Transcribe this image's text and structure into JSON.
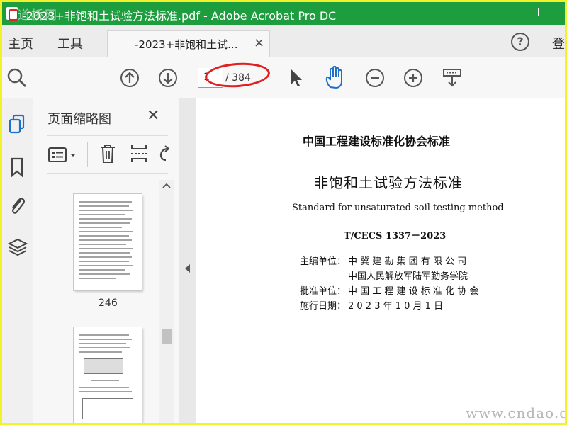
{
  "window": {
    "title": "-2023+非饱和土试验方法标准.pdf - Adobe Acrobat Pro DC",
    "watermark": "道桥网",
    "accent": "#1e9d3f"
  },
  "menu": {
    "home": "主页",
    "tools": "工具",
    "doc_tab": "-2023+非饱和土试...",
    "login": "登"
  },
  "toolbar": {
    "page_current": "1",
    "page_total": "/ 384",
    "icons": [
      "zoom-icon",
      "page-up-icon",
      "page-down-icon",
      "select-arrow-icon",
      "hand-icon",
      "zoom-out-icon",
      "zoom-in-icon",
      "keyboard-scroll-icon"
    ]
  },
  "sidebar": {
    "panel_title": "页面缩略图",
    "thumbnails": [
      {
        "label": "246"
      },
      {
        "label": ""
      }
    ]
  },
  "document": {
    "org_standard": "中国工程建设标准化协会标准",
    "title_cn": "非饱和土试验方法标准",
    "title_en": "Standard for unsaturated soil testing method",
    "code": "T/CECS 1337－2023",
    "editor_label": "主编单位：",
    "editor_1": "中 冀 建 勘 集 团 有 限 公 司",
    "editor_2": "中国人民解放军陆军勤务学院",
    "approver_label": "批准单位：",
    "approver": "中 国 工 程 建 设 标 准 化 协 会",
    "date_label": "施行日期：",
    "date": "2 0 2 3  年  1 0  月  1  日"
  },
  "footer_watermark": "www.cndao.com"
}
